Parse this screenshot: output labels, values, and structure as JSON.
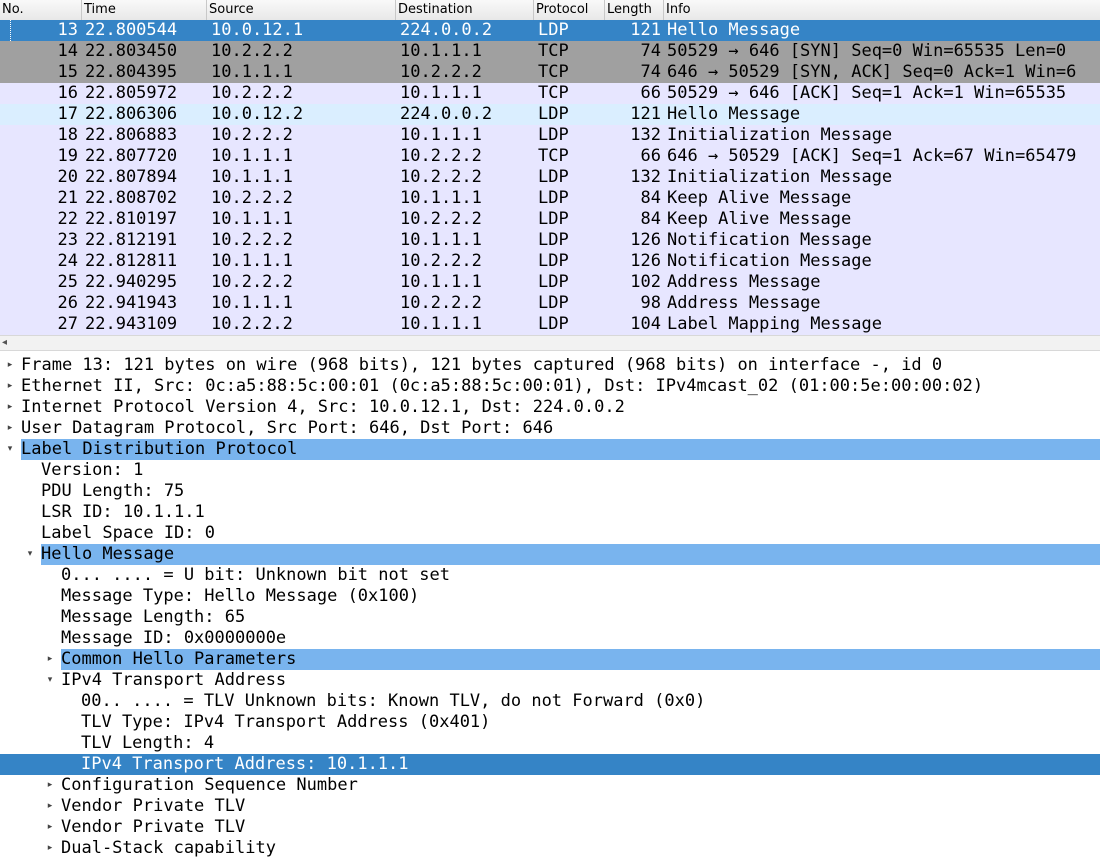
{
  "columns": {
    "no": "No.",
    "time": "Time",
    "source": "Source",
    "destination": "Destination",
    "protocol": "Protocol",
    "length": "Length",
    "info": "Info"
  },
  "packets": [
    {
      "no": "13",
      "time": "22.800544",
      "src": "10.0.12.1",
      "dst": "224.0.0.2",
      "proto": "LDP",
      "len": "121",
      "info": "Hello Message"
    },
    {
      "no": "14",
      "time": "22.803450",
      "src": "10.2.2.2",
      "dst": "10.1.1.1",
      "proto": "TCP",
      "len": "74",
      "info": "50529 → 646 [SYN] Seq=0 Win=65535 Len=0"
    },
    {
      "no": "15",
      "time": "22.804395",
      "src": "10.1.1.1",
      "dst": "10.2.2.2",
      "proto": "TCP",
      "len": "74",
      "info": "646 → 50529 [SYN, ACK] Seq=0 Ack=1 Win=6"
    },
    {
      "no": "16",
      "time": "22.805972",
      "src": "10.2.2.2",
      "dst": "10.1.1.1",
      "proto": "TCP",
      "len": "66",
      "info": "50529 → 646 [ACK] Seq=1 Ack=1 Win=65535"
    },
    {
      "no": "17",
      "time": "22.806306",
      "src": "10.0.12.2",
      "dst": "224.0.0.2",
      "proto": "LDP",
      "len": "121",
      "info": "Hello Message"
    },
    {
      "no": "18",
      "time": "22.806883",
      "src": "10.2.2.2",
      "dst": "10.1.1.1",
      "proto": "LDP",
      "len": "132",
      "info": "Initialization Message"
    },
    {
      "no": "19",
      "time": "22.807720",
      "src": "10.1.1.1",
      "dst": "10.2.2.2",
      "proto": "TCP",
      "len": "66",
      "info": "646 → 50529 [ACK] Seq=1 Ack=67 Win=65479"
    },
    {
      "no": "20",
      "time": "22.807894",
      "src": "10.1.1.1",
      "dst": "10.2.2.2",
      "proto": "LDP",
      "len": "132",
      "info": "Initialization Message"
    },
    {
      "no": "21",
      "time": "22.808702",
      "src": "10.2.2.2",
      "dst": "10.1.1.1",
      "proto": "LDP",
      "len": "84",
      "info": "Keep Alive Message"
    },
    {
      "no": "22",
      "time": "22.810197",
      "src": "10.1.1.1",
      "dst": "10.2.2.2",
      "proto": "LDP",
      "len": "84",
      "info": "Keep Alive Message"
    },
    {
      "no": "23",
      "time": "22.812191",
      "src": "10.2.2.2",
      "dst": "10.1.1.1",
      "proto": "LDP",
      "len": "126",
      "info": "Notification Message"
    },
    {
      "no": "24",
      "time": "22.812811",
      "src": "10.1.1.1",
      "dst": "10.2.2.2",
      "proto": "LDP",
      "len": "126",
      "info": "Notification Message"
    },
    {
      "no": "25",
      "time": "22.940295",
      "src": "10.2.2.2",
      "dst": "10.1.1.1",
      "proto": "LDP",
      "len": "102",
      "info": "Address Message"
    },
    {
      "no": "26",
      "time": "22.941943",
      "src": "10.1.1.1",
      "dst": "10.2.2.2",
      "proto": "LDP",
      "len": "98",
      "info": "Address Message"
    },
    {
      "no": "27",
      "time": "22.943109",
      "src": "10.2.2.2",
      "dst": "10.1.1.1",
      "proto": "LDP",
      "len": "104",
      "info": "Label Mapping Message"
    }
  ],
  "details": [
    {
      "text": "Frame 13: 121 bytes on wire (968 bits), 121 bytes captured (968 bits) on interface -, id 0",
      "state": "collapsed"
    },
    {
      "text": "Ethernet II, Src: 0c:a5:88:5c:00:01 (0c:a5:88:5c:00:01), Dst: IPv4mcast_02 (01:00:5e:00:00:02)",
      "state": "collapsed"
    },
    {
      "text": "Internet Protocol Version 4, Src: 10.0.12.1, Dst: 224.0.0.2",
      "state": "collapsed"
    },
    {
      "text": "User Datagram Protocol, Src Port: 646, Dst Port: 646",
      "state": "collapsed"
    },
    {
      "text": "Label Distribution Protocol",
      "state": "expanded"
    },
    {
      "text": "Version: 1",
      "state": "leaf"
    },
    {
      "text": "PDU Length: 75",
      "state": "leaf"
    },
    {
      "text": "LSR ID: 10.1.1.1",
      "state": "leaf"
    },
    {
      "text": "Label Space ID: 0",
      "state": "leaf"
    },
    {
      "text": "Hello Message",
      "state": "expanded"
    },
    {
      "text": "0... .... = U bit: Unknown bit not set",
      "state": "leaf"
    },
    {
      "text": "Message Type: Hello Message (0x100)",
      "state": "leaf"
    },
    {
      "text": "Message Length: 65",
      "state": "leaf"
    },
    {
      "text": "Message ID: 0x0000000e",
      "state": "leaf"
    },
    {
      "text": "Common Hello Parameters",
      "state": "collapsed"
    },
    {
      "text": "IPv4 Transport Address",
      "state": "expanded"
    },
    {
      "text": "00.. .... = TLV Unknown bits: Known TLV, do not Forward (0x0)",
      "state": "leaf"
    },
    {
      "text": "TLV Type: IPv4 Transport Address (0x401)",
      "state": "leaf"
    },
    {
      "text": "TLV Length: 4",
      "state": "leaf"
    },
    {
      "text": "IPv4 Transport Address: 10.1.1.1",
      "state": "leaf"
    },
    {
      "text": "Configuration Sequence Number",
      "state": "collapsed"
    },
    {
      "text": "Vendor Private TLV",
      "state": "collapsed"
    },
    {
      "text": "Vendor Private TLV",
      "state": "collapsed"
    },
    {
      "text": "Dual-Stack capability",
      "state": "collapsed"
    }
  ],
  "colors": {
    "selected_row": "#3584c6",
    "ldp_tcp_row": "#e7e6ff",
    "udp_row": "#daeeff",
    "syn_row": "#a0a0a0",
    "tree_highlight": "#79b4ee"
  },
  "icons": {
    "collapsed": "triangle-right-icon",
    "expanded": "triangle-down-icon",
    "scroll_left": "scroll-left-arrow-icon"
  }
}
